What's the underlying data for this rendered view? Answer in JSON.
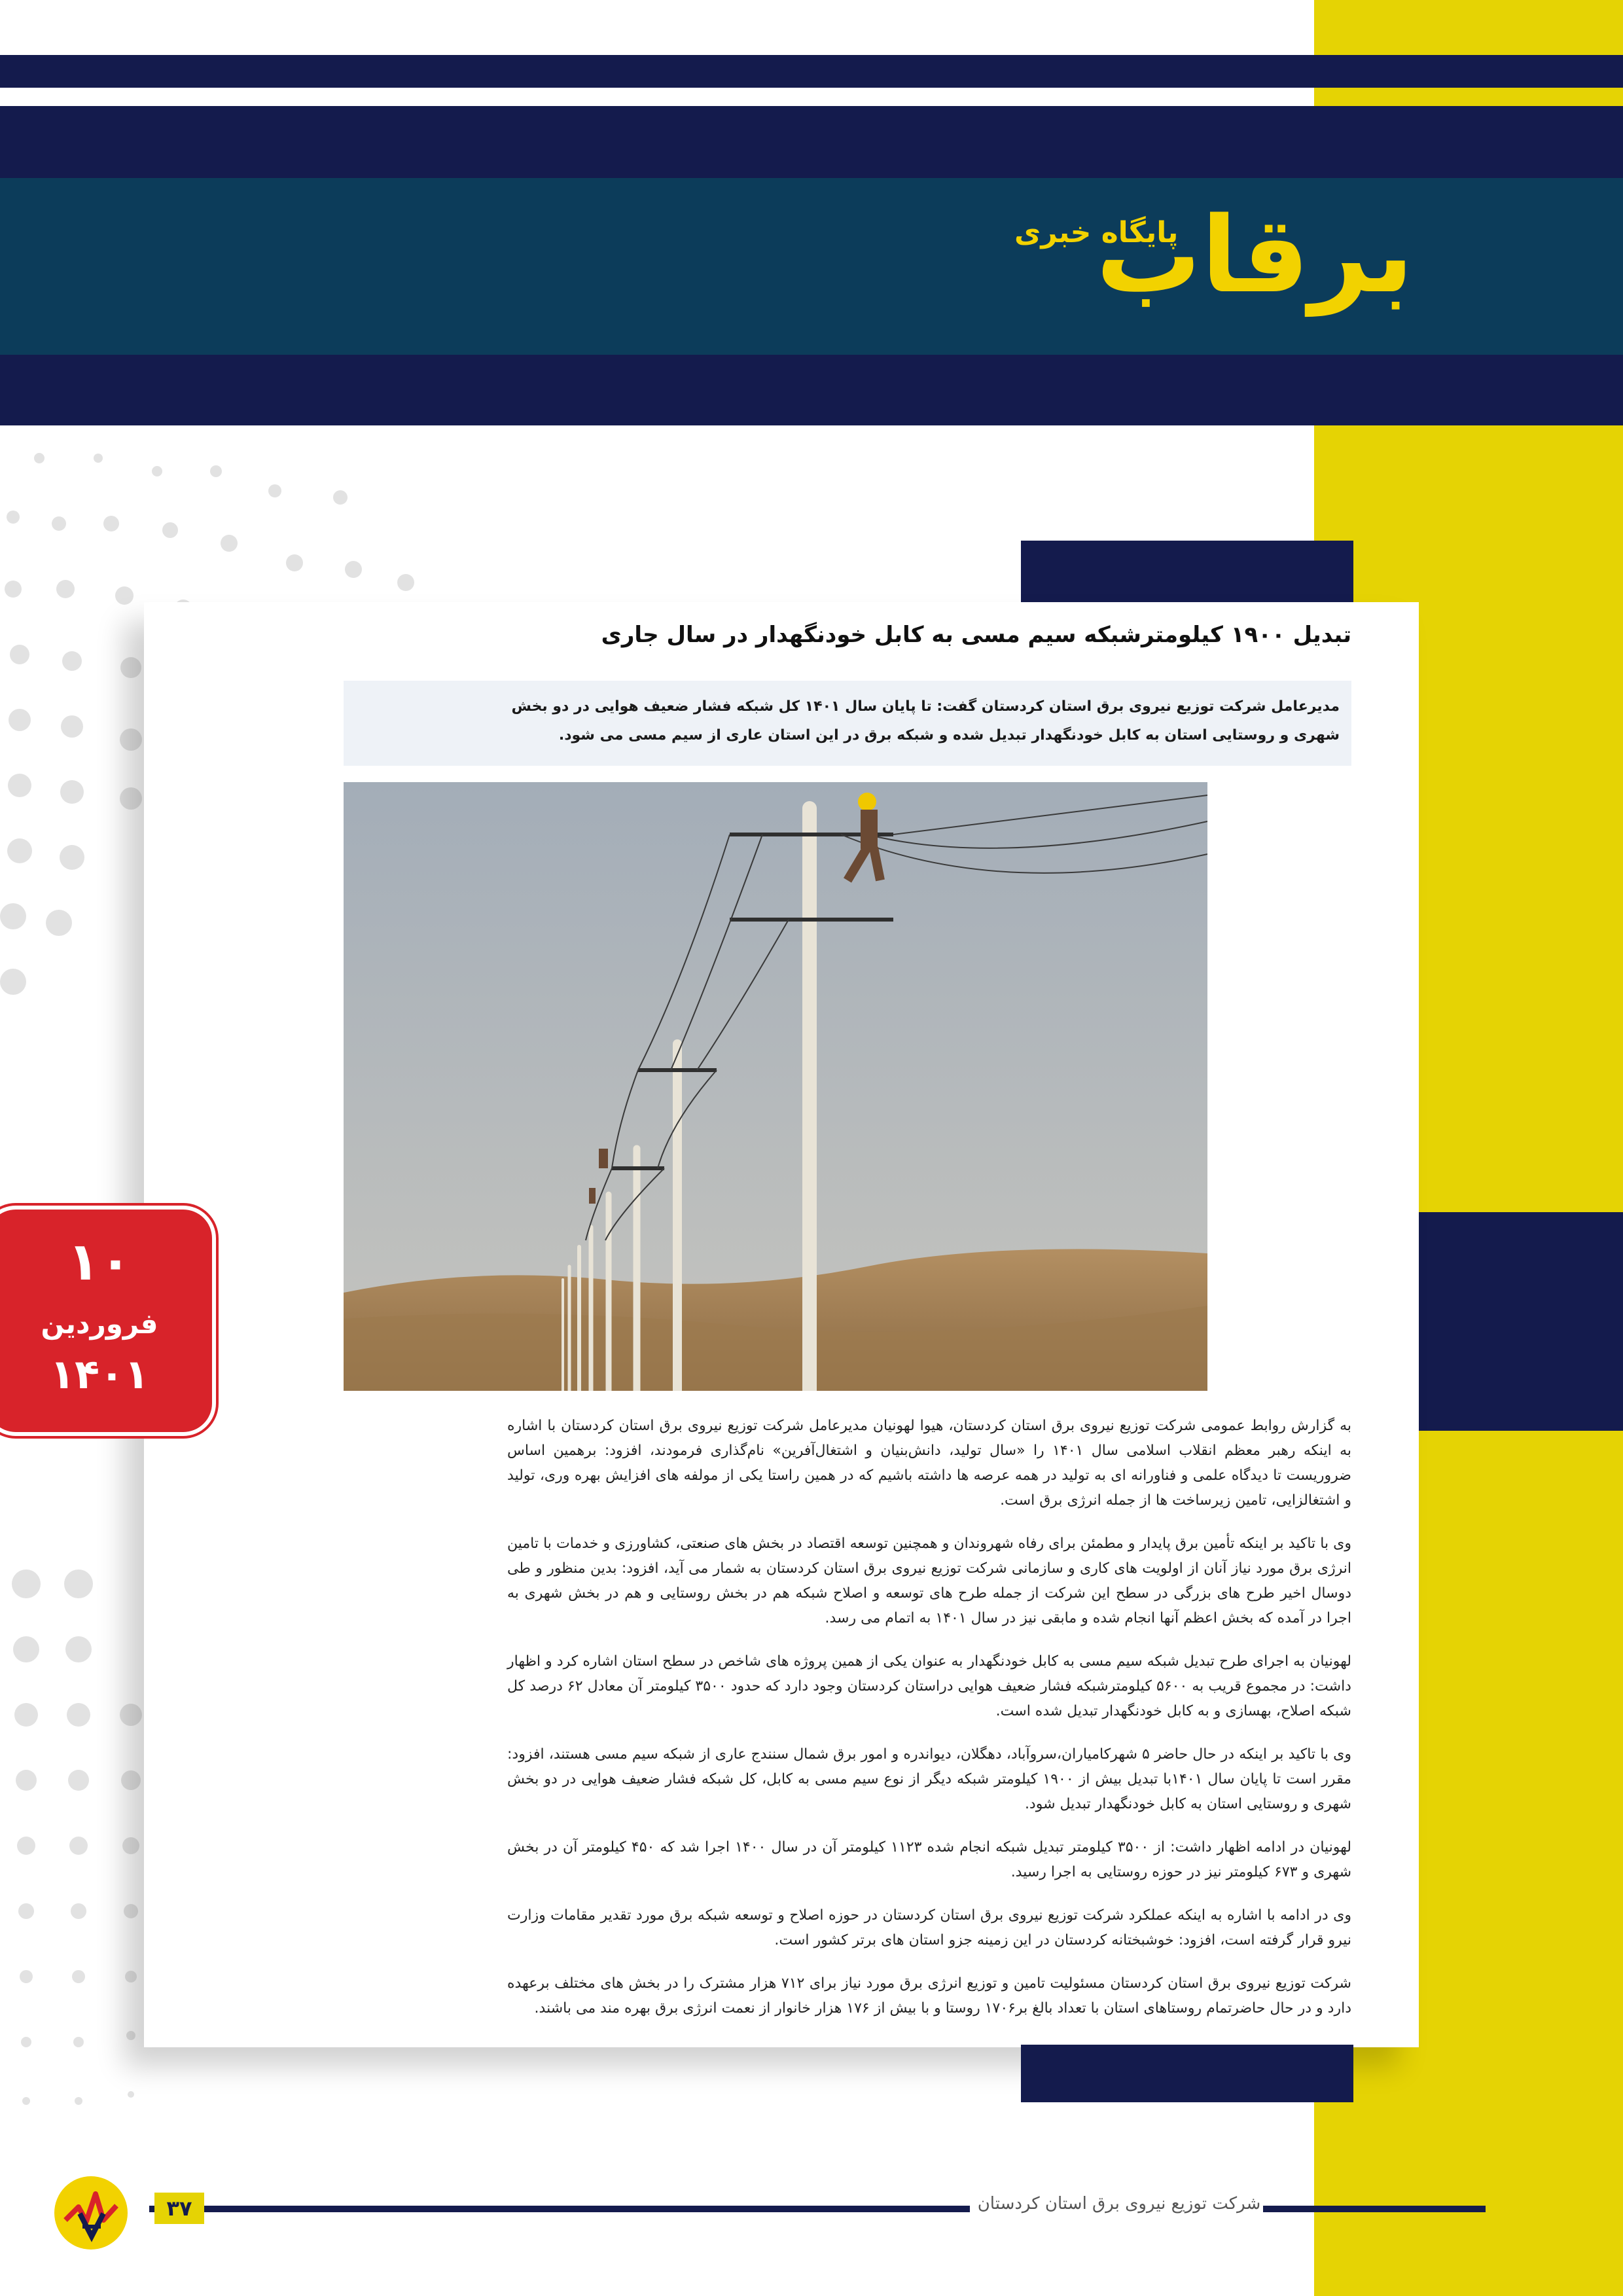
{
  "header": {
    "logo_text": "برقاب",
    "logo_subtitle": "پایگاه خبری"
  },
  "article": {
    "headline": "تبدیل ۱۹۰۰ کیلومترشبکه سیم مسی به کابل خودنگهدار در سال جاری",
    "lead": "مدیرعامل شرکت توزیع نیروی برق استان کردستان گفت: تا پایان سال ۱۴۰۱ کل شبکه فشار ضعیف هوایی در دو بخش شهری و روستایی استان به کابل خودنگهدار تبدیل شده و شبکه برق در این استان عاری از سیم مسی می شود.",
    "paragraphs": [
      "به گزارش روابط عمومی شرکت توزیع نیروی برق استان کردستان، هیوا لهونیان مدیرعامل شرکت توزیع نیروی برق استان کردستان با اشاره به اینکه رهبر معظم انقلاب اسلامی سال ۱۴۰۱ را «سال تولید، دانش‌بنیان و اشتغال‌آفرین» نام‌گذاری فرمودند، افزود: برهمین اساس ضروریست تا دیدگاه علمی و فناورانه ای به تولید در همه عرصه ها داشته باشیم که در همین راستا یکی از مولفه های افزایش بهره وری، تولید و اشتغالزایی، تامین زیرساخت ها از جمله انرژی برق است.",
      "وی با تاکید بر اینکه تأمین برق پایدار و مطمئن برای رفاه شهروندان و همچنین توسعه اقتصاد در بخش های صنعتی، کشاورزی و خدمات با تامین انرژی برق مورد نیاز آنان از اولویت های کاری و سازمانی شرکت توزیع نیروی برق استان کردستان به شمار می آید، افزود: بدین منظور و طی دوسال اخیر طرح های بزرگی در سطح این شرکت از جمله  طرح های توسعه و اصلاح شبکه هم در بخش روستایی و هم در بخش شهری به اجرا در آمده که بخش اعظم آنها انجام شده و مابقی نیز در سال ۱۴۰۱ به اتمام می رسد.",
      "لهونیان به اجرای طرح تبدیل شبکه سیم مسی به کابل خودنگهدار به عنوان یکی از همین پروژه های شاخص در سطح استان اشاره کرد و اظهار داشت: در مجموع قریب به ۵۶۰۰  کیلومترشبکه فشار ضعیف هوایی دراستان کردستان وجود دارد که حدود ۳۵۰۰ کیلومتر آن معادل ۶۲ درصد کل شبکه اصلاح، بهسازی و به کابل خودنگهدار تبدیل شده است.",
      "وی با تاکید بر اینکه در حال حاضر ۵ شهرکامیاران،سروآباد، دهگلان، دیواندره و امور برق شمال سنندج عاری از شبکه سیم مسی هستند، افزود: مقرر است تا پایان سال ۱۴۰۱با تبدیل بیش از ۱۹۰۰ کیلومتر شبکه دیگر از نوع سیم مسی به کابل، کل شبکه فشار ضعیف هوایی در دو بخش شهری و روستایی استان به کابل خودنگهدار تبدیل شود.",
      "لهونیان در ادامه اظهار داشت: از ۳۵۰۰ کیلومتر تبدیل شبکه انجام شده ۱۱۲۳ کیلومتر آن در سال ۱۴۰۰ اجرا شد که ۴۵۰ کیلومتر آن در بخش شهری و ۶۷۳ کیلومتر نیز در حوزه روستایی به اجرا رسید.",
      "وی در ادامه با اشاره به اینکه عملکرد شرکت توزیع نیروی برق استان کردستان در حوزه اصلاح و توسعه شبکه برق مورد تقدیر مقامات وزارت نیرو قرار گرفته است، افزود: خوشبختانه کردستان در این زمینه جزو استان های برتر کشور است.",
      "شرکت توزیع نیروی برق استان کردستان مسئولیت تامین و توزیع انرژی برق مورد نیاز برای ۷۱۲ هزار مشترک را در بخش های مختلف برعهده دارد و در حال حاضرتمام روستاهای استان با تعداد بالغ بر۱۷۰۶ روستا و با بیش از ۱۷۶ هزار خانوار از نعمت انرژی برق بهره مند می باشند."
    ]
  },
  "date_badge": {
    "day": "۱۰",
    "month": "فروردین",
    "year": "۱۴۰۱"
  },
  "footer": {
    "company": "شرکت توزیع نیروی برق استان کردستان",
    "page_number": "۳۷"
  },
  "colors": {
    "navy": "#141b4d",
    "teal": "#0c3c5a",
    "yellow": "#e5d304",
    "logo_yellow": "#f2d200",
    "red": "#d8232a"
  },
  "icons": {
    "footer_logo": "power-company-logo-icon"
  }
}
